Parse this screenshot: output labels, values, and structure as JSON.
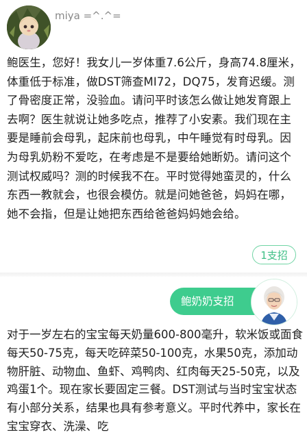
{
  "user": {
    "name": "miya =^.^="
  },
  "question": {
    "text": "鲍医生，您好！我女儿一岁体重7.6公斤，身高74.8厘米，体重低于标准，做DST筛查MI72，DQ75，发育迟缓。测了骨密度正常，没验血。请问平时该怎么做让她发育跟上去啊？医生就说让她多吃点，推荐了小安素。我们现在主要是睡前会母乳，起床前也母乳，中午睡觉有时母乳。因为母乳奶粉不爱吃，在考虑是不是要给她断奶。请问这个测试权威吗？测的时候我不在。平时觉得她蛮灵的，什么东西一教就会，也很会模仿。就是问她爸爸，妈妈在哪，她不会指，但是让她把东西给爸爸妈妈她会给。"
  },
  "support_button": {
    "label": "1支招"
  },
  "expert": {
    "tag": "鲍奶奶支招"
  },
  "answer": {
    "text": "对于一岁左右的宝宝每天奶量600-800毫升，软米饭或面食每天50-75克，每天吃碎菜50-100克，水果50克，添加动物肝脏、动物血、鱼虾、鸡鸭肉、红肉每天25-50克，以及鸡蛋1个。现在家长要固定三餐。DST测试与当时宝宝状态有小部分关系，结果也具有参考意义。平时代养中，家长在宝宝穿衣、洗澡、吃"
  },
  "colors": {
    "accent": "#3ecc8e",
    "button_text": "#3fbf86"
  }
}
